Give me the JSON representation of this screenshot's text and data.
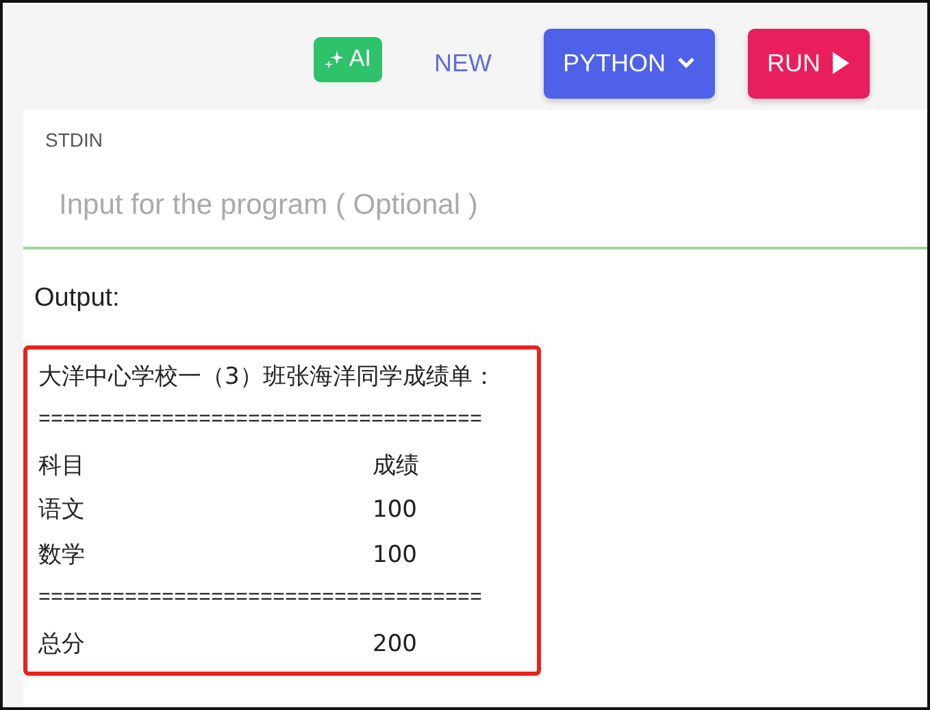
{
  "toolbar": [
    {
      "kind": "ai",
      "label": "AI"
    },
    {
      "kind": "link",
      "label": "NEW"
    },
    {
      "kind": "dropdown",
      "label": "PYTHON"
    },
    {
      "kind": "run",
      "label": "RUN"
    }
  ],
  "stdin": {
    "label": "STDIN",
    "placeholder": "Input for the program ( Optional )"
  },
  "output": {
    "label": "Output:",
    "highlighted": true,
    "lines": [
      {
        "kind": "text",
        "text": "大洋中心学校一（3）班张海洋同学成绩单："
      },
      {
        "kind": "text",
        "text": "===================================="
      },
      {
        "kind": "row",
        "cells": [
          "科目",
          "成绩"
        ]
      },
      {
        "kind": "row",
        "cells": [
          "语文",
          "100"
        ]
      },
      {
        "kind": "row",
        "cells": [
          "数学",
          "100"
        ]
      },
      {
        "kind": "text",
        "text": "===================================="
      },
      {
        "kind": "row",
        "cells": [
          "总分",
          "200"
        ]
      }
    ]
  }
}
